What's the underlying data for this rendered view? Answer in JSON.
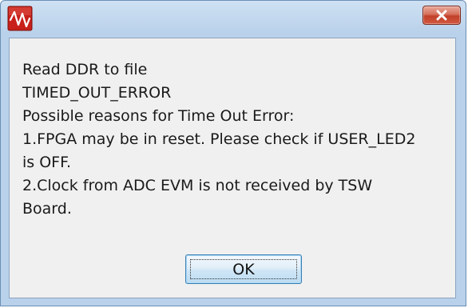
{
  "window": {
    "title": "",
    "app_icon": "waveform-app-icon",
    "close_icon": "close-x-icon"
  },
  "message": {
    "lines": [
      "Read DDR to file",
      "TIMED_OUT_ERROR",
      "Possible reasons for Time Out Error:",
      "1.FPGA may be in reset. Please check if USER_LED2",
      "is OFF.",
      "2.Clock from ADC EVM is not received by TSW",
      "Board."
    ]
  },
  "buttons": {
    "ok_label": "OK"
  },
  "colors": {
    "close_button": "#c1402a",
    "app_icon_bg": "#c8201a",
    "ok_border": "#3c7fb1"
  }
}
